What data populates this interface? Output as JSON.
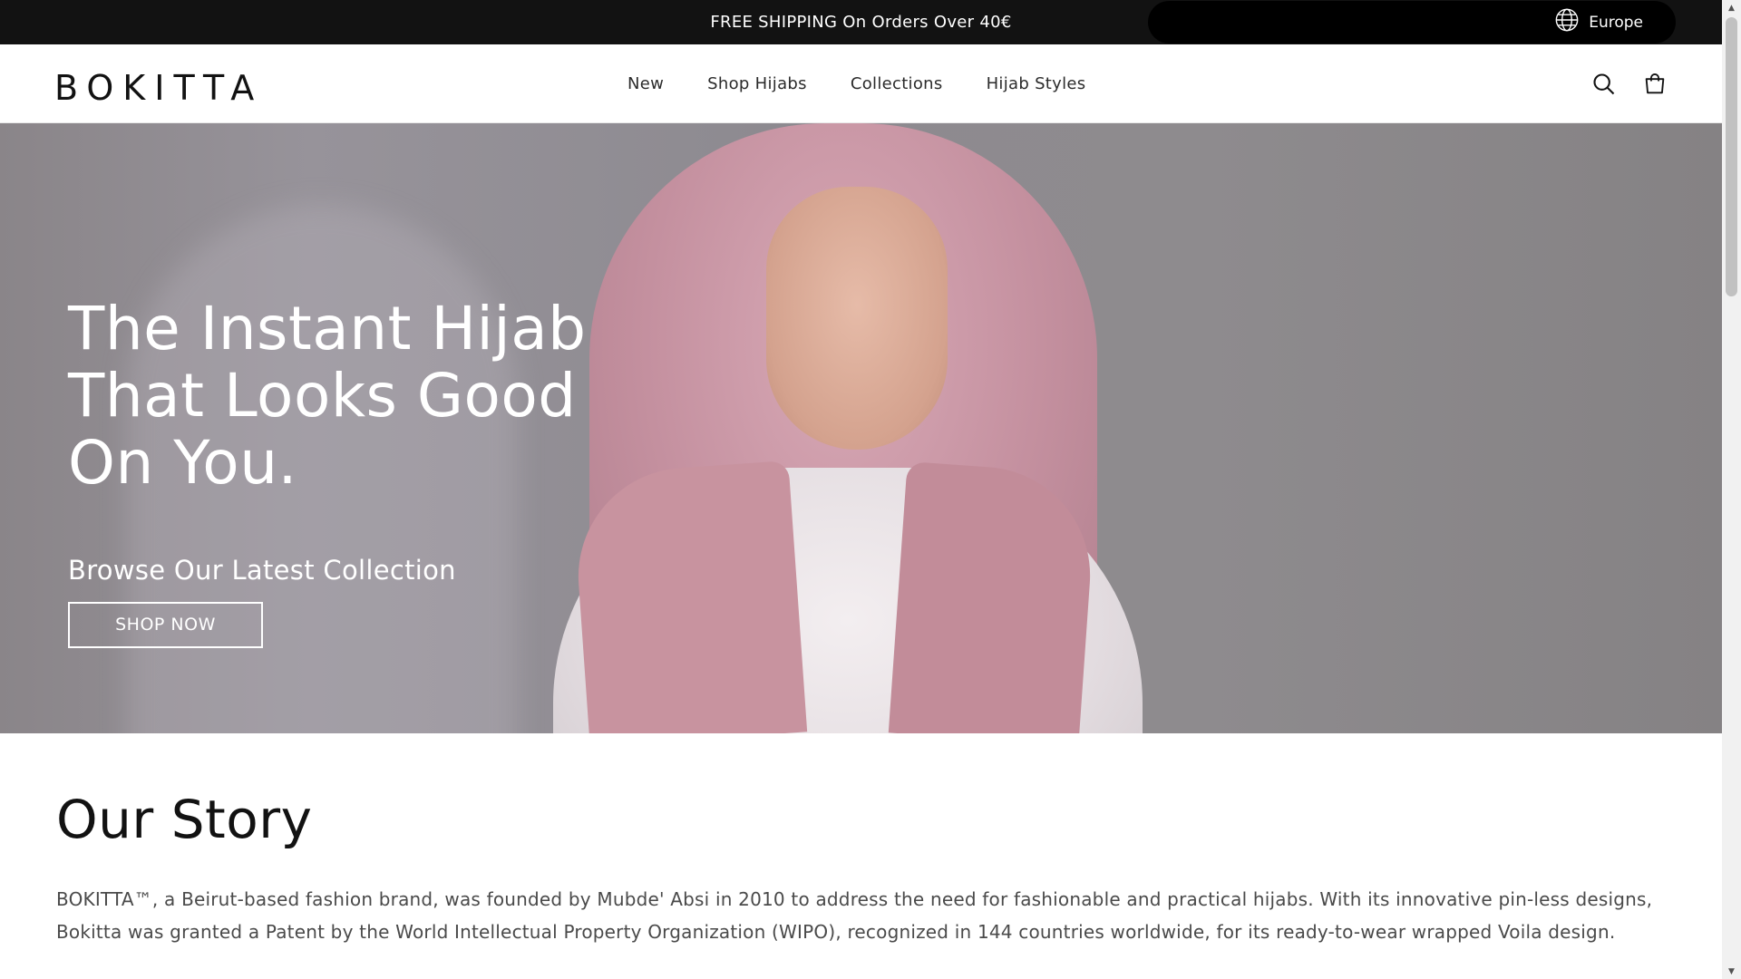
{
  "announcement": {
    "text": "FREE SHIPPING On Orders Over 40€"
  },
  "region": {
    "label": "Europe",
    "icon": "globe-icon"
  },
  "header": {
    "logo": "BOKITTA",
    "nav": [
      "New",
      "Shop Hijabs",
      "Collections",
      "Hijab Styles"
    ],
    "icons": [
      "search-icon",
      "cart-icon"
    ]
  },
  "hero": {
    "title": "The Instant Hijab That Looks Good On You.",
    "subtitle": "Browse Our Latest Collection",
    "button": "SHOP NOW"
  },
  "story": {
    "title": "Our Story",
    "text": "BOKITTA™, a Beirut-based fashion brand, was founded by Mubde' Absi in 2010 to address the need for fashionable and practical hijabs. With its innovative pin-less designs, Bokitta was granted a Patent by the World Intellectual Property Organization (WIPO), recognized in 144 countries worldwide, for its ready-to-wear wrapped Voila design."
  },
  "colors": {
    "bar": "#121212",
    "scarf": "#c4909f",
    "text": "#121212"
  }
}
